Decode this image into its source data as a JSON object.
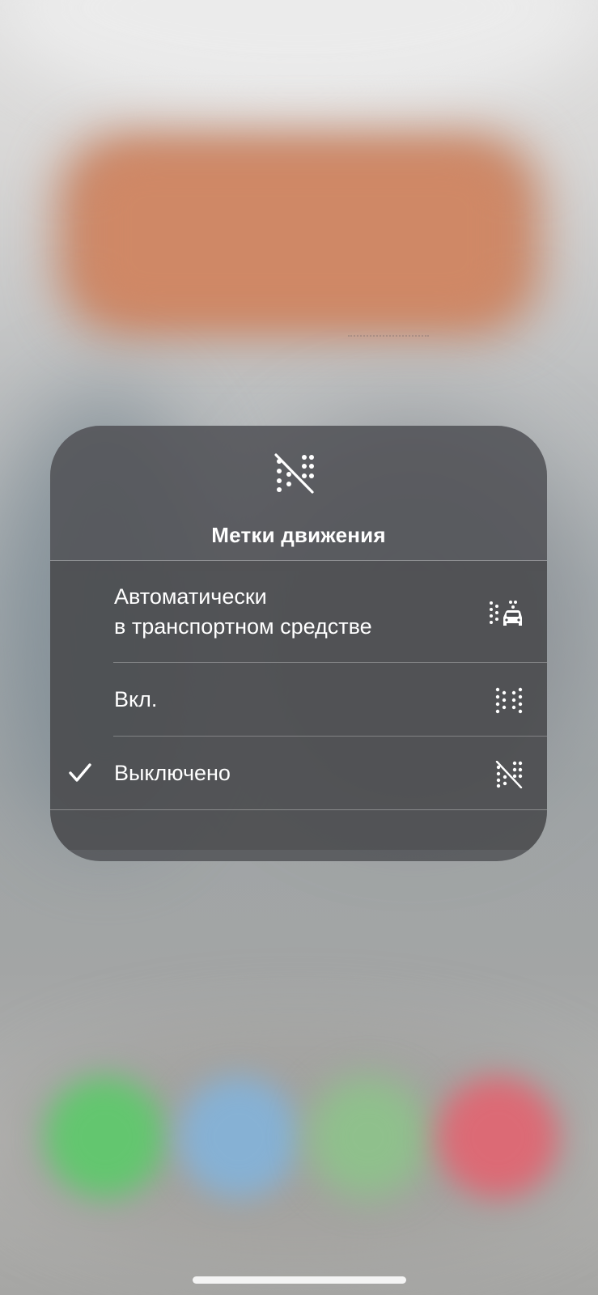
{
  "menu": {
    "title": "Метки движения",
    "header_icon": "motion-cues-off-icon",
    "options": [
      {
        "label_line1": "Автоматически",
        "label_line2": "в транспортном средстве",
        "icon": "motion-cues-vehicle-icon",
        "selected": false
      },
      {
        "label": "Вкл.",
        "icon": "motion-cues-on-icon",
        "selected": false
      },
      {
        "label": "Выключено",
        "icon": "motion-cues-off-icon",
        "selected": true
      }
    ]
  },
  "colors": {
    "panel": "#4a4c50",
    "text": "#ffffff",
    "dock_green": "#63c66f",
    "dock_blue": "#86b1d4",
    "dock_lightgreen": "#8fc08c",
    "dock_red": "#dc6a75",
    "widget_orange": "#cf8866"
  }
}
